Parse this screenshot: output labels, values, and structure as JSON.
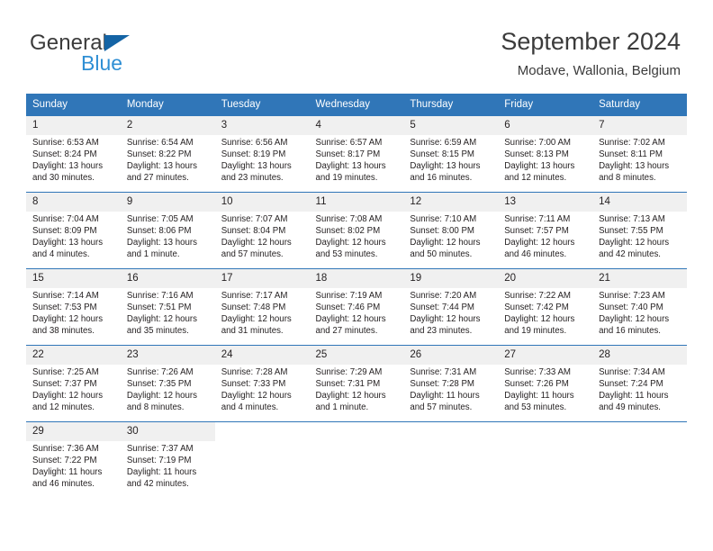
{
  "logo": {
    "word_one": "General",
    "word_two": "Blue",
    "triangle_color": "#1464a5",
    "blue_color": "#2f8fd4"
  },
  "header": {
    "title": "September 2024",
    "subtitle": "Modave, Wallonia, Belgium"
  },
  "theme": {
    "header_blue": "#3076b8",
    "daynum_gray": "#f0f0f0",
    "text": "#231f20"
  },
  "weekdays": [
    "Sunday",
    "Monday",
    "Tuesday",
    "Wednesday",
    "Thursday",
    "Friday",
    "Saturday"
  ],
  "labels": {
    "sunrise": "Sunrise:",
    "sunset": "Sunset:",
    "daylight": "Daylight:"
  },
  "weeks": [
    [
      {
        "day": "1",
        "sunrise": "Sunrise: 6:53 AM",
        "sunset": "Sunset: 8:24 PM",
        "daylight": "Daylight: 13 hours and 30 minutes."
      },
      {
        "day": "2",
        "sunrise": "Sunrise: 6:54 AM",
        "sunset": "Sunset: 8:22 PM",
        "daylight": "Daylight: 13 hours and 27 minutes."
      },
      {
        "day": "3",
        "sunrise": "Sunrise: 6:56 AM",
        "sunset": "Sunset: 8:19 PM",
        "daylight": "Daylight: 13 hours and 23 minutes."
      },
      {
        "day": "4",
        "sunrise": "Sunrise: 6:57 AM",
        "sunset": "Sunset: 8:17 PM",
        "daylight": "Daylight: 13 hours and 19 minutes."
      },
      {
        "day": "5",
        "sunrise": "Sunrise: 6:59 AM",
        "sunset": "Sunset: 8:15 PM",
        "daylight": "Daylight: 13 hours and 16 minutes."
      },
      {
        "day": "6",
        "sunrise": "Sunrise: 7:00 AM",
        "sunset": "Sunset: 8:13 PM",
        "daylight": "Daylight: 13 hours and 12 minutes."
      },
      {
        "day": "7",
        "sunrise": "Sunrise: 7:02 AM",
        "sunset": "Sunset: 8:11 PM",
        "daylight": "Daylight: 13 hours and 8 minutes."
      }
    ],
    [
      {
        "day": "8",
        "sunrise": "Sunrise: 7:04 AM",
        "sunset": "Sunset: 8:09 PM",
        "daylight": "Daylight: 13 hours and 4 minutes."
      },
      {
        "day": "9",
        "sunrise": "Sunrise: 7:05 AM",
        "sunset": "Sunset: 8:06 PM",
        "daylight": "Daylight: 13 hours and 1 minute."
      },
      {
        "day": "10",
        "sunrise": "Sunrise: 7:07 AM",
        "sunset": "Sunset: 8:04 PM",
        "daylight": "Daylight: 12 hours and 57 minutes."
      },
      {
        "day": "11",
        "sunrise": "Sunrise: 7:08 AM",
        "sunset": "Sunset: 8:02 PM",
        "daylight": "Daylight: 12 hours and 53 minutes."
      },
      {
        "day": "12",
        "sunrise": "Sunrise: 7:10 AM",
        "sunset": "Sunset: 8:00 PM",
        "daylight": "Daylight: 12 hours and 50 minutes."
      },
      {
        "day": "13",
        "sunrise": "Sunrise: 7:11 AM",
        "sunset": "Sunset: 7:57 PM",
        "daylight": "Daylight: 12 hours and 46 minutes."
      },
      {
        "day": "14",
        "sunrise": "Sunrise: 7:13 AM",
        "sunset": "Sunset: 7:55 PM",
        "daylight": "Daylight: 12 hours and 42 minutes."
      }
    ],
    [
      {
        "day": "15",
        "sunrise": "Sunrise: 7:14 AM",
        "sunset": "Sunset: 7:53 PM",
        "daylight": "Daylight: 12 hours and 38 minutes."
      },
      {
        "day": "16",
        "sunrise": "Sunrise: 7:16 AM",
        "sunset": "Sunset: 7:51 PM",
        "daylight": "Daylight: 12 hours and 35 minutes."
      },
      {
        "day": "17",
        "sunrise": "Sunrise: 7:17 AM",
        "sunset": "Sunset: 7:48 PM",
        "daylight": "Daylight: 12 hours and 31 minutes."
      },
      {
        "day": "18",
        "sunrise": "Sunrise: 7:19 AM",
        "sunset": "Sunset: 7:46 PM",
        "daylight": "Daylight: 12 hours and 27 minutes."
      },
      {
        "day": "19",
        "sunrise": "Sunrise: 7:20 AM",
        "sunset": "Sunset: 7:44 PM",
        "daylight": "Daylight: 12 hours and 23 minutes."
      },
      {
        "day": "20",
        "sunrise": "Sunrise: 7:22 AM",
        "sunset": "Sunset: 7:42 PM",
        "daylight": "Daylight: 12 hours and 19 minutes."
      },
      {
        "day": "21",
        "sunrise": "Sunrise: 7:23 AM",
        "sunset": "Sunset: 7:40 PM",
        "daylight": "Daylight: 12 hours and 16 minutes."
      }
    ],
    [
      {
        "day": "22",
        "sunrise": "Sunrise: 7:25 AM",
        "sunset": "Sunset: 7:37 PM",
        "daylight": "Daylight: 12 hours and 12 minutes."
      },
      {
        "day": "23",
        "sunrise": "Sunrise: 7:26 AM",
        "sunset": "Sunset: 7:35 PM",
        "daylight": "Daylight: 12 hours and 8 minutes."
      },
      {
        "day": "24",
        "sunrise": "Sunrise: 7:28 AM",
        "sunset": "Sunset: 7:33 PM",
        "daylight": "Daylight: 12 hours and 4 minutes."
      },
      {
        "day": "25",
        "sunrise": "Sunrise: 7:29 AM",
        "sunset": "Sunset: 7:31 PM",
        "daylight": "Daylight: 12 hours and 1 minute."
      },
      {
        "day": "26",
        "sunrise": "Sunrise: 7:31 AM",
        "sunset": "Sunset: 7:28 PM",
        "daylight": "Daylight: 11 hours and 57 minutes."
      },
      {
        "day": "27",
        "sunrise": "Sunrise: 7:33 AM",
        "sunset": "Sunset: 7:26 PM",
        "daylight": "Daylight: 11 hours and 53 minutes."
      },
      {
        "day": "28",
        "sunrise": "Sunrise: 7:34 AM",
        "sunset": "Sunset: 7:24 PM",
        "daylight": "Daylight: 11 hours and 49 minutes."
      }
    ],
    [
      {
        "day": "29",
        "sunrise": "Sunrise: 7:36 AM",
        "sunset": "Sunset: 7:22 PM",
        "daylight": "Daylight: 11 hours and 46 minutes."
      },
      {
        "day": "30",
        "sunrise": "Sunrise: 7:37 AM",
        "sunset": "Sunset: 7:19 PM",
        "daylight": "Daylight: 11 hours and 42 minutes."
      },
      {
        "day": "",
        "sunrise": "",
        "sunset": "",
        "daylight": ""
      },
      {
        "day": "",
        "sunrise": "",
        "sunset": "",
        "daylight": ""
      },
      {
        "day": "",
        "sunrise": "",
        "sunset": "",
        "daylight": ""
      },
      {
        "day": "",
        "sunrise": "",
        "sunset": "",
        "daylight": ""
      },
      {
        "day": "",
        "sunrise": "",
        "sunset": "",
        "daylight": ""
      }
    ]
  ]
}
